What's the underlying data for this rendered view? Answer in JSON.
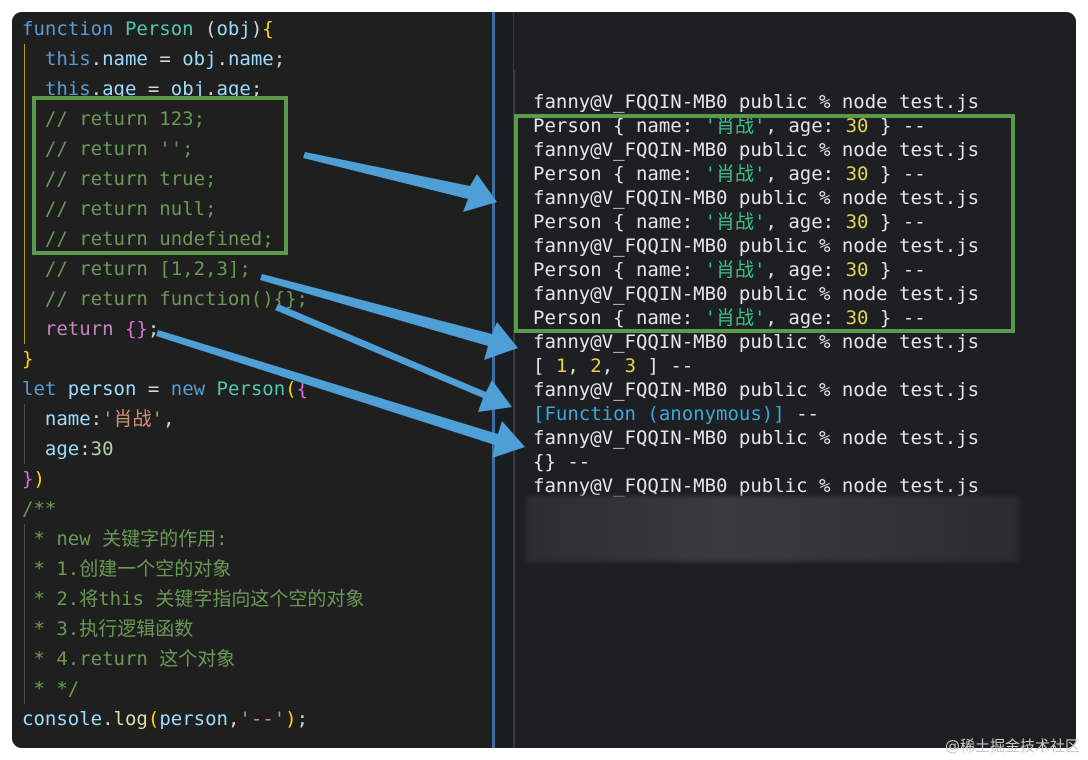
{
  "editor": {
    "code_lines": [
      [
        {
          "t": "function ",
          "c": "kw"
        },
        {
          "t": "Person",
          "c": "fn"
        },
        {
          "t": " (",
          "c": "tx"
        },
        {
          "t": "obj",
          "c": "id"
        },
        {
          "t": ")",
          "c": "tx"
        },
        {
          "t": "{",
          "c": "b1"
        }
      ],
      [
        {
          "t": "  ",
          "c": "tx"
        },
        {
          "t": "this",
          "c": "kw"
        },
        {
          "t": ".",
          "c": "tx"
        },
        {
          "t": "name",
          "c": "id"
        },
        {
          "t": " = ",
          "c": "tx"
        },
        {
          "t": "obj",
          "c": "id"
        },
        {
          "t": ".",
          "c": "tx"
        },
        {
          "t": "name",
          "c": "id"
        },
        {
          "t": ";",
          "c": "tx"
        }
      ],
      [
        {
          "t": "  ",
          "c": "tx"
        },
        {
          "t": "this",
          "c": "kw"
        },
        {
          "t": ".",
          "c": "tx"
        },
        {
          "t": "age",
          "c": "id"
        },
        {
          "t": " = ",
          "c": "tx"
        },
        {
          "t": "obj",
          "c": "id"
        },
        {
          "t": ".",
          "c": "tx"
        },
        {
          "t": "age",
          "c": "id"
        },
        {
          "t": ";",
          "c": "tx"
        }
      ],
      [
        {
          "t": "  // return 123;",
          "c": "cm"
        }
      ],
      [
        {
          "t": "  // return '';",
          "c": "cm"
        }
      ],
      [
        {
          "t": "  // return true;",
          "c": "cm"
        }
      ],
      [
        {
          "t": "  // return null;",
          "c": "cm"
        }
      ],
      [
        {
          "t": "  // return undefined;",
          "c": "cm"
        }
      ],
      [
        {
          "t": "  // return [1,2,3];",
          "c": "cm"
        }
      ],
      [
        {
          "t": "  // return function(){};",
          "c": "cm"
        }
      ],
      [
        {
          "t": "  ",
          "c": "tx"
        },
        {
          "t": "return",
          "c": "kw2"
        },
        {
          "t": " ",
          "c": "tx"
        },
        {
          "t": "{}",
          "c": "b2"
        },
        {
          "t": ";",
          "c": "tx"
        }
      ],
      [
        {
          "t": "}",
          "c": "b1"
        }
      ],
      [
        {
          "t": "let",
          "c": "kw"
        },
        {
          "t": " ",
          "c": "tx"
        },
        {
          "t": "person",
          "c": "id"
        },
        {
          "t": " = ",
          "c": "tx"
        },
        {
          "t": "new",
          "c": "kw"
        },
        {
          "t": " ",
          "c": "tx"
        },
        {
          "t": "Person",
          "c": "fn"
        },
        {
          "t": "(",
          "c": "b1"
        },
        {
          "t": "{",
          "c": "b2"
        }
      ],
      [
        {
          "t": "  ",
          "c": "tx"
        },
        {
          "t": "name",
          "c": "id"
        },
        {
          "t": ":",
          "c": "tx"
        },
        {
          "t": "'肖战'",
          "c": "st"
        },
        {
          "t": ",",
          "c": "tx"
        }
      ],
      [
        {
          "t": "  ",
          "c": "tx"
        },
        {
          "t": "age",
          "c": "id"
        },
        {
          "t": ":",
          "c": "tx"
        },
        {
          "t": "30",
          "c": "nm"
        }
      ],
      [
        {
          "t": "}",
          "c": "b2"
        },
        {
          "t": ")",
          "c": "b1"
        }
      ],
      [
        {
          "t": "/**",
          "c": "cm"
        }
      ],
      [
        {
          "t": " * new 关键字的作用:",
          "c": "cm"
        }
      ],
      [
        {
          "t": " * 1.创建一个空的对象",
          "c": "cm"
        }
      ],
      [
        {
          "t": " * 2.将this 关键字指向这个空的对象",
          "c": "cm"
        }
      ],
      [
        {
          "t": " * 3.执行逻辑函数",
          "c": "cm"
        }
      ],
      [
        {
          "t": " * 4.return 这个对象",
          "c": "cm"
        }
      ],
      [
        {
          "t": " * */",
          "c": "cm"
        }
      ],
      [
        {
          "t": "console",
          "c": "id"
        },
        {
          "t": ".",
          "c": "tx"
        },
        {
          "t": "log",
          "c": "fcall"
        },
        {
          "t": "(",
          "c": "b1"
        },
        {
          "t": "person",
          "c": "id"
        },
        {
          "t": ",",
          "c": "tx"
        },
        {
          "t": "'--'",
          "c": "st"
        },
        {
          "t": ")",
          "c": "b1"
        },
        {
          "t": ";",
          "c": "tx"
        }
      ]
    ]
  },
  "terminal": {
    "lines": [
      [
        {
          "t": "fanny@V_FQQIN-MB0 public % node test.js"
        }
      ],
      [
        {
          "t": "Person { name: "
        },
        {
          "t": "'肖战'",
          "c": "tstr"
        },
        {
          "t": ", age: "
        },
        {
          "t": "30",
          "c": "tnum"
        },
        {
          "t": " } --"
        }
      ],
      [
        {
          "t": "fanny@V_FQQIN-MB0 public % node test.js"
        }
      ],
      [
        {
          "t": "Person { name: "
        },
        {
          "t": "'肖战'",
          "c": "tstr"
        },
        {
          "t": ", age: "
        },
        {
          "t": "30",
          "c": "tnum"
        },
        {
          "t": " } --"
        }
      ],
      [
        {
          "t": "fanny@V_FQQIN-MB0 public % node test.js"
        }
      ],
      [
        {
          "t": "Person { name: "
        },
        {
          "t": "'肖战'",
          "c": "tstr"
        },
        {
          "t": ", age: "
        },
        {
          "t": "30",
          "c": "tnum"
        },
        {
          "t": " } --"
        }
      ],
      [
        {
          "t": "fanny@V_FQQIN-MB0 public % node test.js"
        }
      ],
      [
        {
          "t": "Person { name: "
        },
        {
          "t": "'肖战'",
          "c": "tstr"
        },
        {
          "t": ", age: "
        },
        {
          "t": "30",
          "c": "tnum"
        },
        {
          "t": " } --"
        }
      ],
      [
        {
          "t": "fanny@V_FQQIN-MB0 public % node test.js"
        }
      ],
      [
        {
          "t": "Person { name: "
        },
        {
          "t": "'肖战'",
          "c": "tstr"
        },
        {
          "t": ", age: "
        },
        {
          "t": "30",
          "c": "tnum"
        },
        {
          "t": " } --"
        }
      ],
      [
        {
          "t": "fanny@V_FQQIN-MB0 public % node test.js"
        }
      ],
      [
        {
          "t": "[ "
        },
        {
          "t": "1",
          "c": "tnum"
        },
        {
          "t": ", "
        },
        {
          "t": "2",
          "c": "tnum"
        },
        {
          "t": ", "
        },
        {
          "t": "3",
          "c": "tnum"
        },
        {
          "t": " ] --"
        }
      ],
      [
        {
          "t": "fanny@V_FQQIN-MB0 public % node test.js"
        }
      ],
      [
        {
          "t": "[Function (anonymous)]",
          "c": "tfunc"
        },
        {
          "t": " --"
        }
      ],
      [
        {
          "t": "fanny@V_FQQIN-MB0 public % node test.js"
        }
      ],
      [
        {
          "t": "{} --"
        }
      ],
      [
        {
          "t": "fanny@V_FQQIN-MB0 public % node test.js"
        }
      ]
    ]
  },
  "annotations": {
    "highlight_color": "#5a9a4a",
    "arrow_color": "#4d9fd6"
  },
  "watermark": "@稀土掘金技术社区"
}
